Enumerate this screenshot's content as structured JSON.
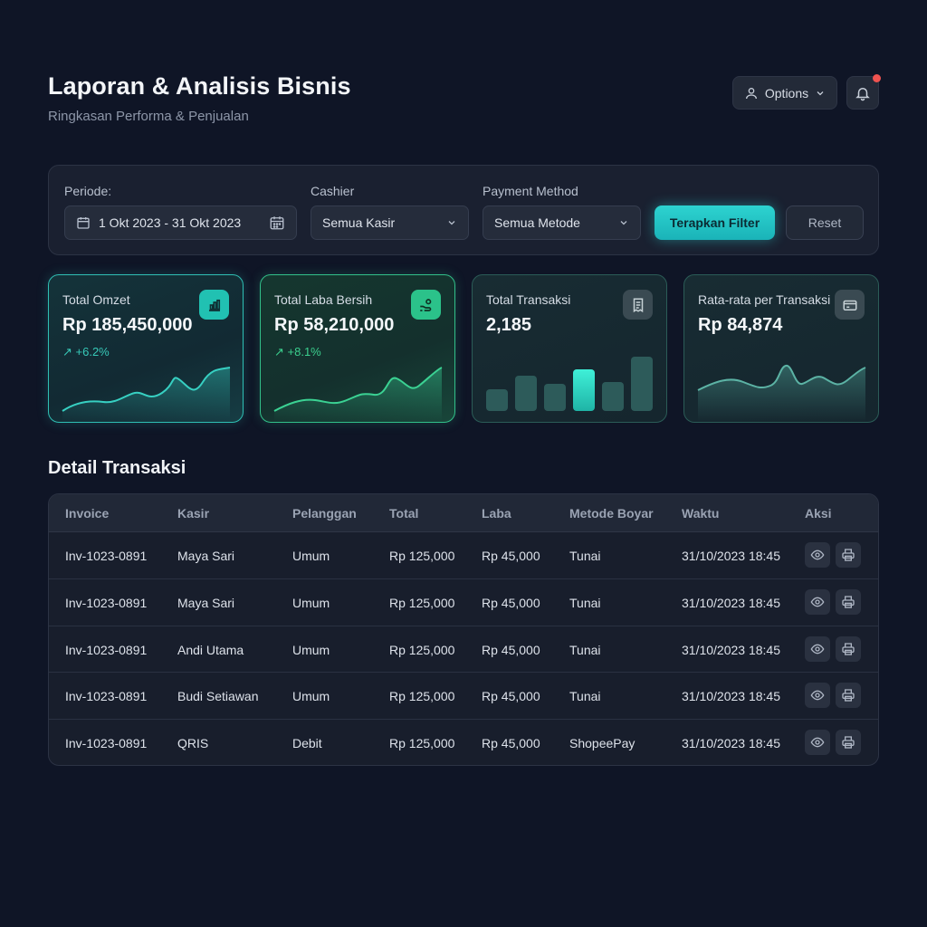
{
  "header": {
    "title": "Laporan & Analisis Bisnis",
    "subtitle": "Ringkasan Performa & Penjualan",
    "options_label": "Options"
  },
  "filters": {
    "period_label": "Periode:",
    "period_value": "1 Okt 2023 - 31 Okt 2023",
    "cashier_label": "Cashier",
    "cashier_value": "Semua Kasir",
    "payment_label": "Payment Method",
    "payment_value": "Semua Metode",
    "apply_label": "Terapkan Filter",
    "reset_label": "Reset"
  },
  "cards": [
    {
      "label": "Total Omzet",
      "value": "Rp 185,450,000",
      "change": "↗ +6.2%",
      "icon": "bar-chart-icon",
      "color": "#21c1b2"
    },
    {
      "label": "Total Laba Bersih",
      "value": "Rp 58,210,000",
      "change": "↗ +8.1%",
      "icon": "hand-coin-icon",
      "color": "#2bc28a"
    },
    {
      "label": "Total Transaksi",
      "value": "2,185",
      "icon": "receipt-icon"
    },
    {
      "label": "Rata-rata per Transaksi",
      "value": "Rp 84,874",
      "icon": "credit-card-icon"
    }
  ],
  "section_title": "Detail Transaksi",
  "table": {
    "columns": [
      "Invoice",
      "Kasir",
      "Pelanggan",
      "Total",
      "Laba",
      "Metode Boyar",
      "Waktu",
      "Aksi"
    ],
    "rows": [
      [
        "Inv-1023-0891",
        "Maya Sari",
        "Umum",
        "Rp 125,000",
        "Rp 45,000",
        "Tunai",
        "31/10/2023 18:45"
      ],
      [
        "Inv-1023-0891",
        "Maya Sari",
        "Umum",
        "Rp 125,000",
        "Rp 45,000",
        "Tunai",
        "31/10/2023 18:45"
      ],
      [
        "Inv-1023-0891",
        "Andi Utama",
        "Umum",
        "Rp 125,000",
        "Rp 45,000",
        "Tunai",
        "31/10/2023 18:45"
      ],
      [
        "Inv-1023-0891",
        "Budi Setiawan",
        "Umum",
        "Rp 125,000",
        "Rp 45,000",
        "Tunai",
        "31/10/2023 18:45"
      ],
      [
        "Inv-1023-0891",
        "QRIS",
        "Debit",
        "Rp 125,000",
        "Rp 45,000",
        "ShopeePay",
        "31/10/2023 18:45"
      ]
    ]
  },
  "colors": {
    "background": "#0f1526",
    "accent_teal": "#2dd3d0",
    "accent_green": "#2bc28a",
    "notification": "#ef5350"
  }
}
